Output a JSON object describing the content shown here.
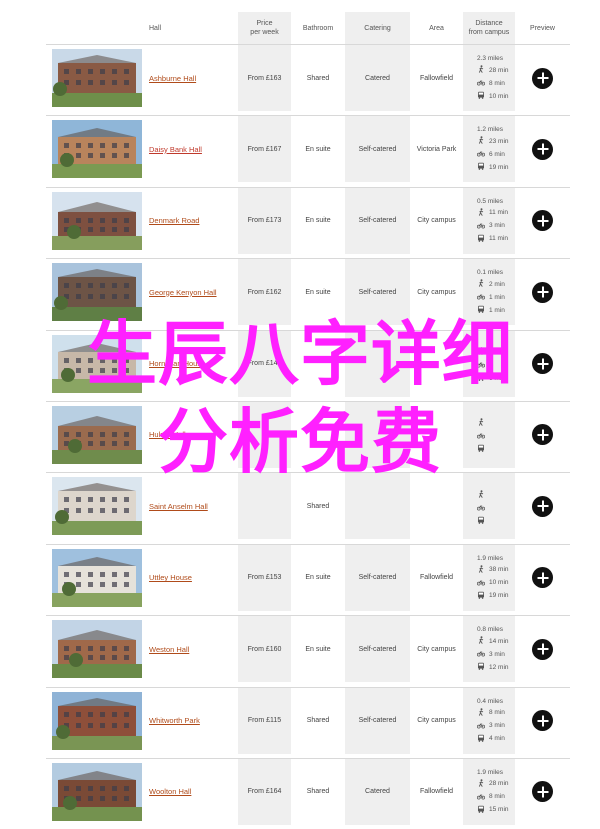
{
  "headers": {
    "hall": "Hall",
    "price": "Price\nper week",
    "bathroom": "Bathroom",
    "catering": "Catering",
    "area": "Area",
    "distance": "Distance\nfrom campus",
    "preview": "Preview"
  },
  "rows": [
    {
      "name": "Ashburne Hall",
      "price": "From £163",
      "bathroom": "Shared",
      "catering": "Catered",
      "area": "Fallowfield",
      "miles": "2.3 miles",
      "walk": "28 min",
      "cycle": "8 min",
      "bus": "10 min",
      "active": false
    },
    {
      "name": "Daisy Bank Hall",
      "price": "From £167",
      "bathroom": "En suite",
      "catering": "Self-catered",
      "area": "Victoria Park",
      "miles": "1.2 miles",
      "walk": "23 min",
      "cycle": "6 min",
      "bus": "19 min",
      "active": true
    },
    {
      "name": "Denmark Road",
      "price": "From £173",
      "bathroom": "En suite",
      "catering": "Self-catered",
      "area": "City campus",
      "miles": "0.5 miles",
      "walk": "11 min",
      "cycle": "3 min",
      "bus": "11 min",
      "active": false
    },
    {
      "name": "George Kenyon Hall",
      "price": "From £162",
      "bathroom": "En suite",
      "catering": "Self-catered",
      "area": "City campus",
      "miles": "0.1 miles",
      "walk": "2 min",
      "cycle": "1 min",
      "bus": "1 min",
      "active": false
    },
    {
      "name": "Horniman House",
      "price": "From £149",
      "bathroom": "",
      "catering": "",
      "area": "",
      "miles": "",
      "walk": "",
      "cycle": "",
      "bus": "6 min",
      "active": false
    },
    {
      "name": "Hulme Hall",
      "price": "",
      "bathroom": "",
      "catering": "",
      "area": "",
      "miles": "",
      "walk": "",
      "cycle": "",
      "bus": "",
      "active": false
    },
    {
      "name": "Saint Anselm Hall",
      "price": "",
      "bathroom": "Shared",
      "catering": "",
      "area": "",
      "miles": "",
      "walk": "",
      "cycle": "",
      "bus": "",
      "active": false
    },
    {
      "name": "Uttley House",
      "price": "From £153",
      "bathroom": "En suite",
      "catering": "Self-catered",
      "area": "Fallowfield",
      "miles": "1.9 miles",
      "walk": "38 min",
      "cycle": "10 min",
      "bus": "19 min",
      "active": false
    },
    {
      "name": "Weston Hall",
      "price": "From £160",
      "bathroom": "En suite",
      "catering": "Self-catered",
      "area": "City campus",
      "miles": "0.8 miles",
      "walk": "14 min",
      "cycle": "3 min",
      "bus": "12 min",
      "active": false
    },
    {
      "name": "Whitworth Park",
      "price": "From £115",
      "bathroom": "Shared",
      "catering": "Self-catered",
      "area": "City campus",
      "miles": "0.4 miles",
      "walk": "8 min",
      "cycle": "3 min",
      "bus": "4 min",
      "active": false
    },
    {
      "name": "Woolton Hall",
      "price": "From £164",
      "bathroom": "Shared",
      "catering": "Catered",
      "area": "Fallowfield",
      "miles": "1.9 miles",
      "walk": "28 min",
      "cycle": "8 min",
      "bus": "15 min",
      "active": false
    }
  ],
  "overlay": {
    "line1": "生辰八字详细",
    "line2": "分析免费"
  },
  "colors": {
    "link": "#b04b1a",
    "link_active": "#c0392b",
    "overlay": "#ff20ff",
    "header_shade": "#efefef"
  }
}
